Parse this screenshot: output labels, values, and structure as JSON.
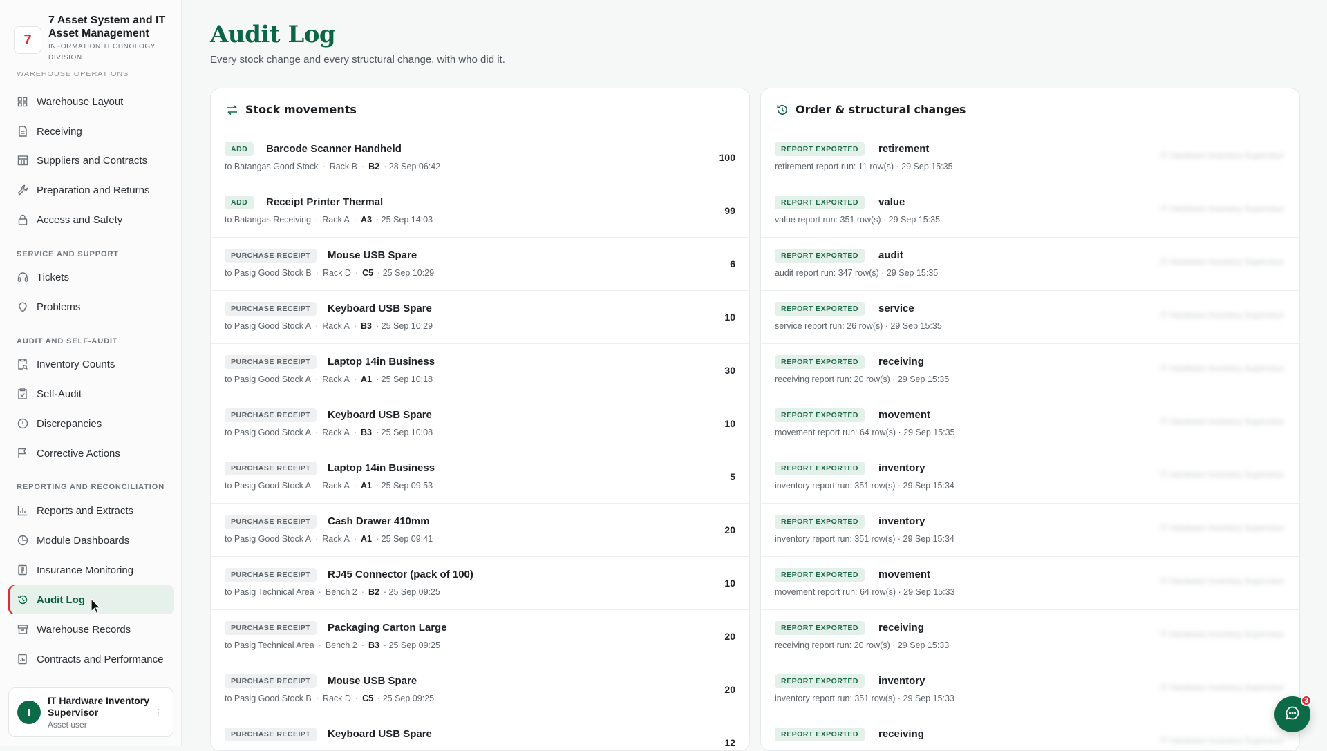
{
  "brand": {
    "title": "7 Asset System and IT Asset Management",
    "subtitle": "INFORMATION TECHNOLOGY DIVISION",
    "logo_text": "7"
  },
  "sidebar": {
    "cutoff_label": "WAREHOUSE OPERATIONS",
    "items": [
      {
        "label": "Warehouse Layout",
        "icon": "grid-icon"
      },
      {
        "label": "Receiving",
        "icon": "file-icon"
      },
      {
        "label": "Suppliers and Contracts",
        "icon": "building-icon"
      },
      {
        "label": "Preparation and Returns",
        "icon": "wrench-icon"
      },
      {
        "label": "Access and Safety",
        "icon": "lock-icon"
      },
      {
        "label": "Tickets",
        "icon": "headset-icon"
      },
      {
        "label": "Problems",
        "icon": "lightbulb-icon"
      },
      {
        "label": "Inventory Counts",
        "icon": "clipboard-search-icon"
      },
      {
        "label": "Self-Audit",
        "icon": "clipboard-check-icon"
      },
      {
        "label": "Discrepancies",
        "icon": "alert-circle-icon"
      },
      {
        "label": "Corrective Actions",
        "icon": "flag-icon"
      },
      {
        "label": "Reports and Extracts",
        "icon": "bar-chart-icon"
      },
      {
        "label": "Module Dashboards",
        "icon": "pie-chart-icon"
      },
      {
        "label": "Insurance Monitoring",
        "icon": "shield-document-icon"
      },
      {
        "label": "Audit Log",
        "icon": "history-icon"
      },
      {
        "label": "Warehouse Records",
        "icon": "archive-icon"
      },
      {
        "label": "Contracts and Performance",
        "icon": "document-chart-icon"
      }
    ],
    "sections": {
      "service": "SERVICE AND SUPPORT",
      "audit": "AUDIT AND SELF-AUDIT",
      "reporting": "REPORTING AND RECONCILIATION"
    },
    "active": "Audit Log"
  },
  "user": {
    "initial": "I",
    "name": "IT Hardware Inventory Supervisor",
    "role": "Asset user"
  },
  "page": {
    "title": "Audit Log",
    "subtitle": "Every stock change and every structural change, with who did it."
  },
  "stock_panel": {
    "title": "Stock movements",
    "rows": [
      {
        "badge": "ADD",
        "type": "add",
        "item": "Barcode Scanner Handheld",
        "location": "to Batangas Good Stock",
        "rack": "Rack B",
        "bin": "B2",
        "time": "· 28 Sep 06:42",
        "qty": "100"
      },
      {
        "badge": "ADD",
        "type": "add",
        "item": "Receipt Printer Thermal",
        "location": "to Batangas Receiving",
        "rack": "Rack A",
        "bin": "A3",
        "time": "· 25 Sep 14:03",
        "qty": "99"
      },
      {
        "badge": "PURCHASE RECEIPT",
        "type": "purchase",
        "item": "Mouse USB Spare",
        "location": "to Pasig Good Stock B",
        "rack": "Rack D",
        "bin": "C5",
        "time": "· 25 Sep 10:29",
        "qty": "6"
      },
      {
        "badge": "PURCHASE RECEIPT",
        "type": "purchase",
        "item": "Keyboard USB Spare",
        "location": "to Pasig Good Stock A",
        "rack": "Rack A",
        "bin": "B3",
        "time": "· 25 Sep 10:29",
        "qty": "10"
      },
      {
        "badge": "PURCHASE RECEIPT",
        "type": "purchase",
        "item": "Laptop 14in Business",
        "location": "to Pasig Good Stock A",
        "rack": "Rack A",
        "bin": "A1",
        "time": "· 25 Sep 10:18",
        "qty": "30"
      },
      {
        "badge": "PURCHASE RECEIPT",
        "type": "purchase",
        "item": "Keyboard USB Spare",
        "location": "to Pasig Good Stock A",
        "rack": "Rack A",
        "bin": "B3",
        "time": "· 25 Sep 10:08",
        "qty": "10"
      },
      {
        "badge": "PURCHASE RECEIPT",
        "type": "purchase",
        "item": "Laptop 14in Business",
        "location": "to Pasig Good Stock A",
        "rack": "Rack A",
        "bin": "A1",
        "time": "· 25 Sep 09:53",
        "qty": "5"
      },
      {
        "badge": "PURCHASE RECEIPT",
        "type": "purchase",
        "item": "Cash Drawer 410mm",
        "location": "to Pasig Good Stock A",
        "rack": "Rack A",
        "bin": "A1",
        "time": "· 25 Sep 09:41",
        "qty": "20"
      },
      {
        "badge": "PURCHASE RECEIPT",
        "type": "purchase",
        "item": "RJ45 Connector (pack of 100)",
        "location": "to Pasig Technical Area",
        "rack": "Bench 2",
        "bin": "B2",
        "time": "· 25 Sep 09:25",
        "qty": "10"
      },
      {
        "badge": "PURCHASE RECEIPT",
        "type": "purchase",
        "item": "Packaging Carton Large",
        "location": "to Pasig Technical Area",
        "rack": "Bench 2",
        "bin": "B3",
        "time": "· 25 Sep 09:25",
        "qty": "20"
      },
      {
        "badge": "PURCHASE RECEIPT",
        "type": "purchase",
        "item": "Mouse USB Spare",
        "location": "to Pasig Good Stock B",
        "rack": "Rack D",
        "bin": "C5",
        "time": "· 25 Sep 09:25",
        "qty": "20"
      },
      {
        "badge": "PURCHASE RECEIPT",
        "type": "purchase",
        "item": "Keyboard USB Spare",
        "location": "",
        "rack": "",
        "bin": "",
        "time": "",
        "qty": "12"
      }
    ]
  },
  "changes_panel": {
    "title": "Order & structural changes",
    "rows": [
      {
        "badge": "REPORT EXPORTED",
        "name": "retirement",
        "meta": "retirement report run: 11 row(s) · 29 Sep 15:35"
      },
      {
        "badge": "REPORT EXPORTED",
        "name": "value",
        "meta": "value report run: 351 row(s) · 29 Sep 15:35"
      },
      {
        "badge": "REPORT EXPORTED",
        "name": "audit",
        "meta": "audit report run: 347 row(s) · 29 Sep 15:35"
      },
      {
        "badge": "REPORT EXPORTED",
        "name": "service",
        "meta": "service report run: 26 row(s) · 29 Sep 15:35"
      },
      {
        "badge": "REPORT EXPORTED",
        "name": "receiving",
        "meta": "receiving report run: 20 row(s) · 29 Sep 15:35"
      },
      {
        "badge": "REPORT EXPORTED",
        "name": "movement",
        "meta": "movement report run: 64 row(s) · 29 Sep 15:35"
      },
      {
        "badge": "REPORT EXPORTED",
        "name": "inventory",
        "meta": "inventory report run: 351 row(s) · 29 Sep 15:34"
      },
      {
        "badge": "REPORT EXPORTED",
        "name": "inventory",
        "meta": "inventory report run: 351 row(s) · 29 Sep 15:34"
      },
      {
        "badge": "REPORT EXPORTED",
        "name": "movement",
        "meta": "movement report run: 64 row(s) · 29 Sep 15:33"
      },
      {
        "badge": "REPORT EXPORTED",
        "name": "receiving",
        "meta": "receiving report run: 20 row(s) · 29 Sep 15:33"
      },
      {
        "badge": "REPORT EXPORTED",
        "name": "inventory",
        "meta": "inventory report run: 351 row(s) · 29 Sep 15:33"
      },
      {
        "badge": "REPORT EXPORTED",
        "name": "receiving",
        "meta": ""
      }
    ]
  },
  "chat": {
    "unread": "3"
  },
  "colors": {
    "brand_green": "#0c6645",
    "accent_red": "#d62f3a",
    "active_bg": "#e6f1ec"
  }
}
